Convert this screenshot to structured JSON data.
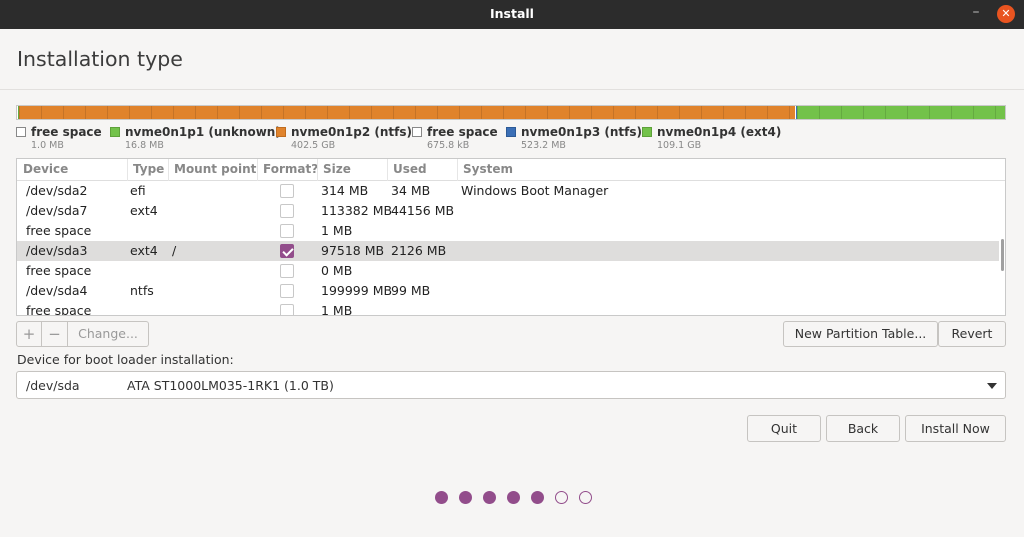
{
  "window": {
    "title": "Install",
    "min_icon": "–",
    "close_icon": "✕"
  },
  "page": {
    "title": "Installation type"
  },
  "partition_bar": {
    "overlay_text": "",
    "colors": {
      "orange": "#e0832c",
      "green": "#73c24a",
      "white": "#ffffff",
      "blue": "#3b6fb6"
    }
  },
  "legend": [
    {
      "name": "free space",
      "size": "1.0 MB",
      "color": "#ffffff"
    },
    {
      "name": "nvme0n1p1 (unknown)",
      "size": "16.8 MB",
      "color": "#73c24a"
    },
    {
      "name": "nvme0n1p2 (ntfs)",
      "size": "402.5 GB",
      "color": "#e0832c"
    },
    {
      "name": "free space",
      "size": "675.8 kB",
      "color": "#ffffff"
    },
    {
      "name": "nvme0n1p3 (ntfs)",
      "size": "523.2 MB",
      "color": "#3b6fb6"
    },
    {
      "name": "nvme0n1p4 (ext4)",
      "size": "109.1 GB",
      "color": "#73c24a"
    }
  ],
  "table": {
    "headers": {
      "device": "Device",
      "type": "Type",
      "mount": "Mount point",
      "format": "Format?",
      "size": "Size",
      "used": "Used",
      "system": "System"
    },
    "rows": [
      {
        "device": "/dev/sda2",
        "type": "efi",
        "mount": "",
        "format": false,
        "size": "314 MB",
        "used": "34 MB",
        "system": "Windows Boot Manager"
      },
      {
        "device": "/dev/sda7",
        "type": "ext4",
        "mount": "",
        "format": false,
        "size": "113382 MB",
        "used": "44156 MB",
        "system": ""
      },
      {
        "device": "free space",
        "type": "",
        "mount": "",
        "format": false,
        "size": "1 MB",
        "used": "",
        "system": ""
      },
      {
        "device": "/dev/sda3",
        "type": "ext4",
        "mount": "/",
        "format": true,
        "size": "97518 MB",
        "used": "2126 MB",
        "system": ""
      },
      {
        "device": "free space",
        "type": "",
        "mount": "",
        "format": false,
        "size": "0 MB",
        "used": "",
        "system": ""
      },
      {
        "device": "/dev/sda4",
        "type": "ntfs",
        "mount": "",
        "format": false,
        "size": "199999 MB",
        "used": "99 MB",
        "system": ""
      },
      {
        "device": "free space",
        "type": "",
        "mount": "",
        "format": false,
        "size": "1 MB",
        "used": "",
        "system": ""
      }
    ],
    "selected_index": 3
  },
  "toolbar": {
    "add": "+",
    "remove": "−",
    "change": "Change...",
    "new_table": "New Partition Table...",
    "revert": "Revert"
  },
  "boot_loader": {
    "label": "Device for boot loader installation:",
    "device": "/dev/sda",
    "description": "ATA ST1000LM035-1RK1 (1.0 TB)"
  },
  "buttons": {
    "quit": "Quit",
    "back": "Back",
    "install": "Install Now"
  },
  "progress": {
    "steps_total": 7,
    "steps_done": 5,
    "accent": "#924d8b"
  }
}
